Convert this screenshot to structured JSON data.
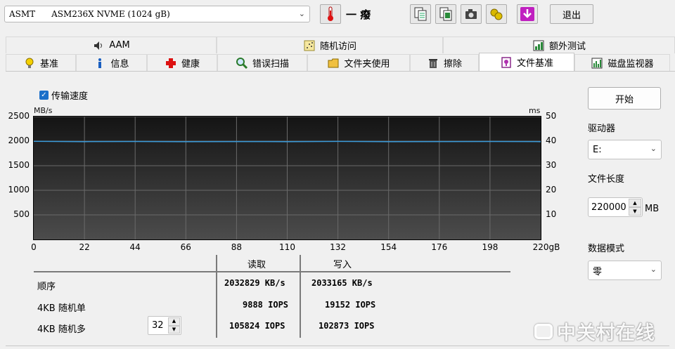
{
  "toolbar": {
    "drive": "ASMT      ASM236X NVME (1024 gB)",
    "temperature": "一 癈",
    "exit_label": "退出",
    "icons": [
      "copy-text-icon",
      "copy-report-icon",
      "camera-icon",
      "tools-icon",
      "download-icon"
    ]
  },
  "tabs_top": [
    {
      "label": "AAM",
      "icon": "speaker-icon"
    },
    {
      "label": "随机访问",
      "icon": "random-access-icon"
    },
    {
      "label": "额外测试",
      "icon": "extra-tests-icon"
    }
  ],
  "tabs_bottom": [
    {
      "label": "基准",
      "icon": "bulb-icon"
    },
    {
      "label": "信息",
      "icon": "info-icon"
    },
    {
      "label": "健康",
      "icon": "health-cross-icon"
    },
    {
      "label": "错误扫描",
      "icon": "magnifier-icon"
    },
    {
      "label": "文件夹使用",
      "icon": "folder-icon"
    },
    {
      "label": "擦除",
      "icon": "trash-icon"
    },
    {
      "label": "文件基准",
      "icon": "file-benchmark-icon",
      "active": true
    },
    {
      "label": "磁盘监视器",
      "icon": "disk-monitor-icon"
    }
  ],
  "transfer_speed_label": "传输速度",
  "chart_data": {
    "type": "line",
    "left_axis_unit": "MB/s",
    "right_axis_unit": "ms",
    "y_ticks_left": [
      "2500",
      "2000",
      "1500",
      "1000",
      "500"
    ],
    "y_ticks_right": [
      "50",
      "40",
      "30",
      "20",
      "10"
    ],
    "x_ticks": [
      "0",
      "22",
      "44",
      "66",
      "88",
      "110",
      "132",
      "154",
      "176",
      "198",
      "220gB"
    ],
    "ylim_left": [
      0,
      2500
    ],
    "ylim_right": [
      0,
      50
    ],
    "xlim": [
      0,
      220
    ],
    "grid": true,
    "series": [
      {
        "color": "#3a9ad9",
        "x": [
          0,
          22,
          44,
          66,
          88,
          110,
          132,
          154,
          176,
          198,
          220
        ],
        "y": [
          1995,
          1990,
          1993,
          1988,
          1992,
          1990,
          1994,
          1989,
          1991,
          1993,
          1990
        ]
      }
    ]
  },
  "right_panel": {
    "start_label": "开始",
    "drive_label": "驱动器",
    "drive_value": "E:",
    "file_length_label": "文件长度",
    "file_length_value": "220000",
    "file_length_unit": "MB",
    "data_mode_label": "数据模式",
    "data_mode_value": "零"
  },
  "results": {
    "read_header": "读取",
    "write_header": "写入",
    "rows": [
      {
        "label": "顺序",
        "read": "2032829 KB/s",
        "write": "2033165 KB/s"
      },
      {
        "label": "4KB 随机单",
        "read": "9888 IOPS",
        "write": "19152 IOPS"
      },
      {
        "label": "4KB 随机多",
        "read": "105824 IOPS",
        "write": "102873 IOPS"
      }
    ],
    "queue_depth": "32"
  },
  "watermark": "中关村在线",
  "colors": {
    "accent": "#1a6fc9",
    "plot_bg_top": "#141414",
    "plot_bg_bottom": "#4c4c4c",
    "series": "#3a9ad9"
  }
}
